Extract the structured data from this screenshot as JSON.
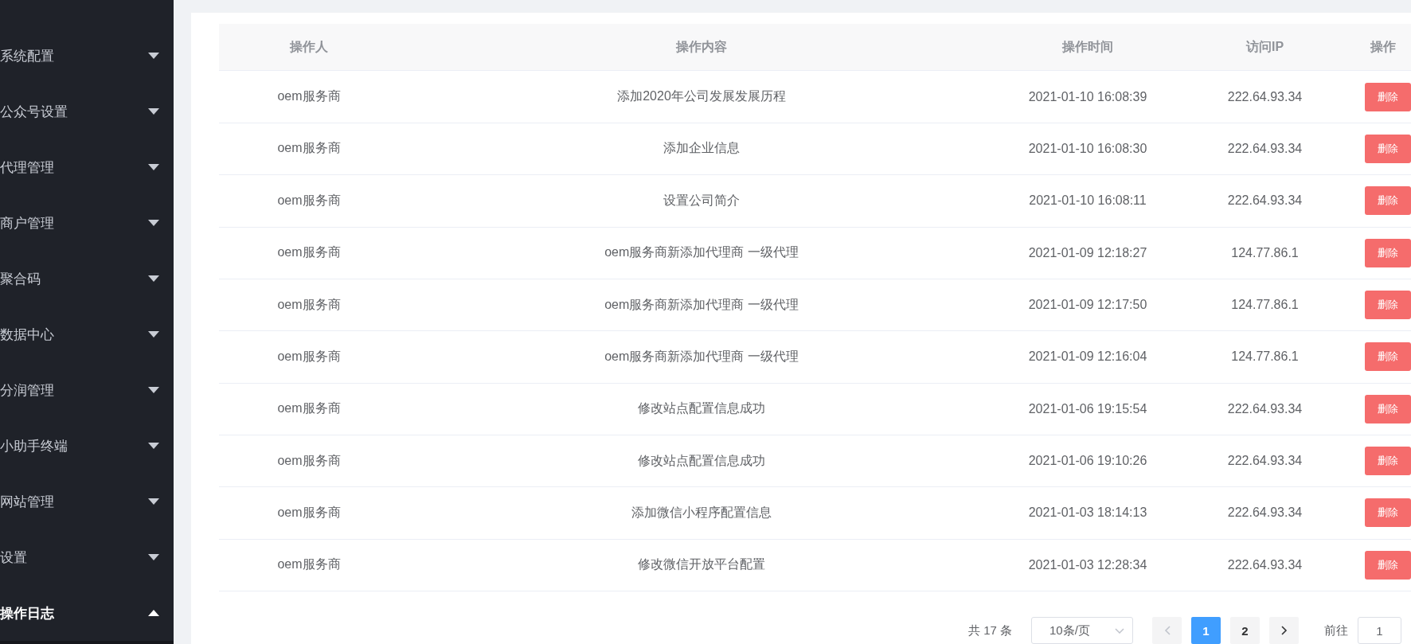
{
  "sidebar": {
    "items": [
      {
        "label": "系统配置",
        "expanded": false
      },
      {
        "label": "公众号设置",
        "expanded": false
      },
      {
        "label": "代理管理",
        "expanded": false
      },
      {
        "label": "商户管理",
        "expanded": false
      },
      {
        "label": "聚合码",
        "expanded": false
      },
      {
        "label": "数据中心",
        "expanded": false
      },
      {
        "label": "分润管理",
        "expanded": false
      },
      {
        "label": "小助手终端",
        "expanded": false
      },
      {
        "label": "网站管理",
        "expanded": false
      },
      {
        "label": "设置",
        "expanded": false
      },
      {
        "label": "操作日志",
        "expanded": true
      }
    ]
  },
  "table": {
    "columns": [
      "操作人",
      "操作内容",
      "操作时间",
      "访问IP",
      "操作"
    ],
    "rows": [
      {
        "operator": "oem服务商",
        "content": "添加2020年公司发展发展历程",
        "time": "2021-01-10 16:08:39",
        "ip": "222.64.93.34",
        "action": "删除"
      },
      {
        "operator": "oem服务商",
        "content": "添加企业信息",
        "time": "2021-01-10 16:08:30",
        "ip": "222.64.93.34",
        "action": "删除"
      },
      {
        "operator": "oem服务商",
        "content": "设置公司简介",
        "time": "2021-01-10 16:08:11",
        "ip": "222.64.93.34",
        "action": "删除"
      },
      {
        "operator": "oem服务商",
        "content": "oem服务商新添加代理商 一级代理",
        "time": "2021-01-09 12:18:27",
        "ip": "124.77.86.1",
        "action": "删除"
      },
      {
        "operator": "oem服务商",
        "content": "oem服务商新添加代理商 一级代理",
        "time": "2021-01-09 12:17:50",
        "ip": "124.77.86.1",
        "action": "删除"
      },
      {
        "operator": "oem服务商",
        "content": "oem服务商新添加代理商 一级代理",
        "time": "2021-01-09 12:16:04",
        "ip": "124.77.86.1",
        "action": "删除"
      },
      {
        "operator": "oem服务商",
        "content": "修改站点配置信息成功",
        "time": "2021-01-06 19:15:54",
        "ip": "222.64.93.34",
        "action": "删除"
      },
      {
        "operator": "oem服务商",
        "content": "修改站点配置信息成功",
        "time": "2021-01-06 19:10:26",
        "ip": "222.64.93.34",
        "action": "删除"
      },
      {
        "operator": "oem服务商",
        "content": "添加微信小程序配置信息",
        "time": "2021-01-03 18:14:13",
        "ip": "222.64.93.34",
        "action": "删除"
      },
      {
        "operator": "oem服务商",
        "content": "修改微信开放平台配置",
        "time": "2021-01-03 12:28:34",
        "ip": "222.64.93.34",
        "action": "删除"
      }
    ]
  },
  "pagination": {
    "total": "共 17 条",
    "page_size": "10条/页",
    "pages": [
      {
        "label": "1",
        "selected": true
      },
      {
        "label": "2",
        "selected": false
      }
    ],
    "goto_label": "前往",
    "goto_value": "1"
  }
}
